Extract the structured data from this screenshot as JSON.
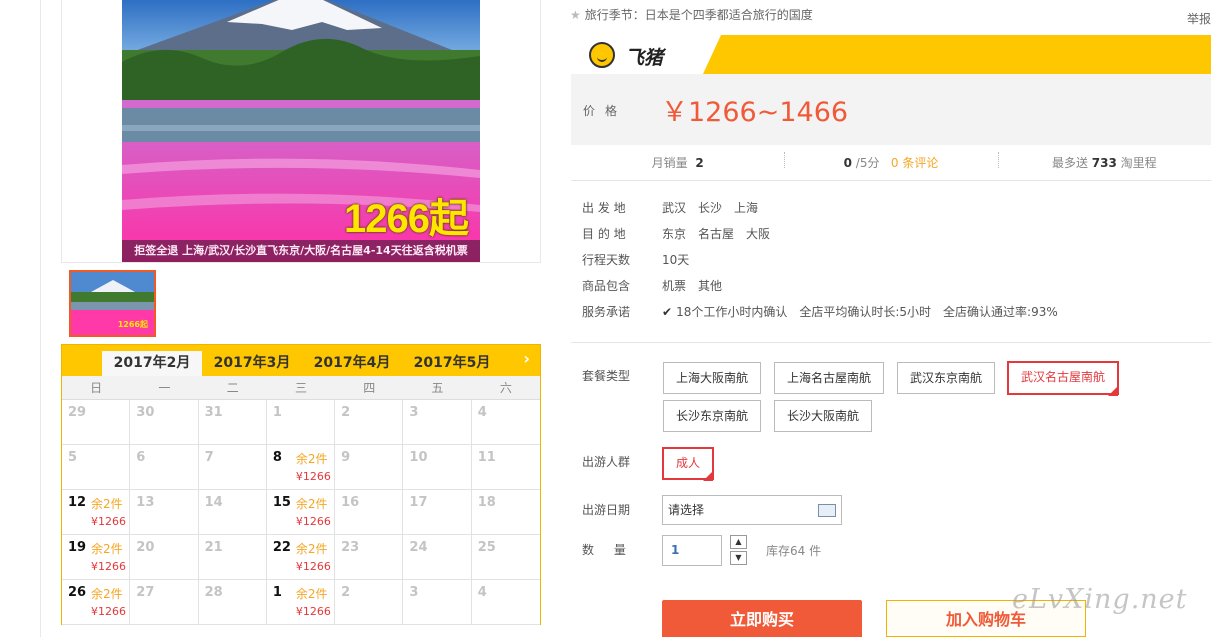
{
  "gallery": {
    "hero_big_text": "1266起",
    "hero_caption": "拒签全退 上海/武汉/长沙直飞东京/大阪/名古屋4-14天往返含税机票",
    "thumb_text": "1266起"
  },
  "calendar": {
    "months": [
      "2017年2月",
      "2017年3月",
      "2017年4月",
      "2017年5月"
    ],
    "next_icon": "chevron-right-icon",
    "weekdays": [
      "日",
      "一",
      "二",
      "三",
      "四",
      "五",
      "六"
    ],
    "rows": [
      [
        {
          "d": "29"
        },
        {
          "d": "30"
        },
        {
          "d": "31"
        },
        {
          "d": "1"
        },
        {
          "d": "2"
        },
        {
          "d": "3"
        },
        {
          "d": "4"
        }
      ],
      [
        {
          "d": "5"
        },
        {
          "d": "6"
        },
        {
          "d": "7"
        },
        {
          "d": "8",
          "on": true,
          "stock": "余2件",
          "price": "¥1266"
        },
        {
          "d": "9"
        },
        {
          "d": "10"
        },
        {
          "d": "11"
        }
      ],
      [
        {
          "d": "12",
          "on": true,
          "stock": "余2件",
          "price": "¥1266"
        },
        {
          "d": "13"
        },
        {
          "d": "14"
        },
        {
          "d": "15",
          "on": true,
          "stock": "余2件",
          "price": "¥1266"
        },
        {
          "d": "16"
        },
        {
          "d": "17"
        },
        {
          "d": "18"
        }
      ],
      [
        {
          "d": "19",
          "on": true,
          "stock": "余2件",
          "price": "¥1266"
        },
        {
          "d": "20"
        },
        {
          "d": "21"
        },
        {
          "d": "22",
          "on": true,
          "stock": "余2件",
          "price": "¥1266"
        },
        {
          "d": "23"
        },
        {
          "d": "24"
        },
        {
          "d": "25"
        }
      ],
      [
        {
          "d": "26",
          "on": true,
          "stock": "余2件",
          "price": "¥1266"
        },
        {
          "d": "27"
        },
        {
          "d": "28"
        },
        {
          "d": "1",
          "on": true,
          "stock": "余2件",
          "price": "¥1266"
        },
        {
          "d": "2"
        },
        {
          "d": "3"
        },
        {
          "d": "4"
        }
      ]
    ]
  },
  "topbar": {
    "text": "旅行季节：日本是个四季都适合旅行的国度",
    "report": "举报"
  },
  "brand": {
    "name": "飞猪"
  },
  "price": {
    "label": "价格",
    "value": "￥1266~1466"
  },
  "stats": {
    "sales_label": "月销量",
    "sales_value": "2",
    "rating_value": "0",
    "rating_suffix": "/5分",
    "reviews": "0 条评论",
    "points_prefix": "最多送",
    "points_value": "733",
    "points_suffix": "淘里程"
  },
  "info": [
    {
      "k": "出 发 地",
      "v": [
        "武汉",
        "长沙",
        "上海"
      ]
    },
    {
      "k": "目 的 地",
      "v": [
        "东京",
        "名古屋",
        "大阪"
      ]
    },
    {
      "k": "行程天数",
      "v": [
        "10天"
      ]
    },
    {
      "k": "商品包含",
      "v": [
        "机票",
        "其他"
      ]
    },
    {
      "k": "服务承诺",
      "v": [
        "18个工作小时内确认",
        "全店平均确认时长:5小时",
        "全店确认通过率:93%"
      ]
    }
  ],
  "package": {
    "label": "套餐类型",
    "options": [
      "上海大阪南航",
      "上海名古屋南航",
      "武汉东京南航",
      "武汉名古屋南航",
      "长沙东京南航",
      "长沙大阪南航"
    ],
    "selected": "武汉名古屋南航"
  },
  "crowd": {
    "label": "出游人群",
    "option": "成人"
  },
  "date": {
    "label": "出游日期",
    "value": "请选择"
  },
  "quantity": {
    "label": "数 量",
    "value": "1",
    "stock": "库存64 件"
  },
  "actions": {
    "buy": "立即购买",
    "cart": "加入购物车"
  },
  "watermark": "eLvXing.net",
  "colors": {
    "accent": "#ffc700",
    "price": "#f05a38",
    "selected": "#e4393c"
  }
}
